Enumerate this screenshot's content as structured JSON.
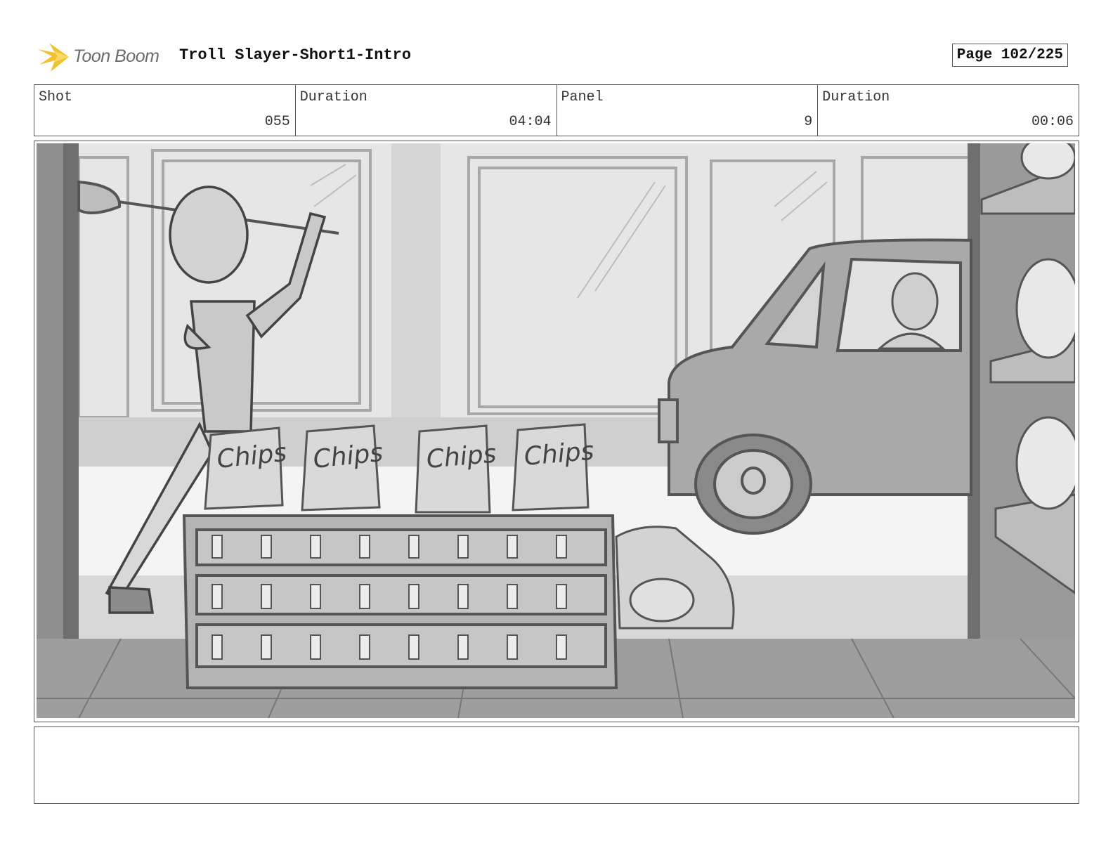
{
  "header": {
    "logo_text": "Toon Boom",
    "project_title": "Troll Slayer-Short1-Intro",
    "page_label": "Page 102/225"
  },
  "info": {
    "shot_label": "Shot",
    "shot_value": "055",
    "shot_duration_label": "Duration",
    "shot_duration_value": "04:04",
    "panel_label": "Panel",
    "panel_value": "9",
    "panel_duration_label": "Duration",
    "panel_duration_value": "00:06"
  },
  "panel": {
    "chips_label": "Chips"
  },
  "notes": {
    "text": ""
  },
  "colors": {
    "logo_accent": "#f2c12e",
    "frame_border": "#555555"
  }
}
